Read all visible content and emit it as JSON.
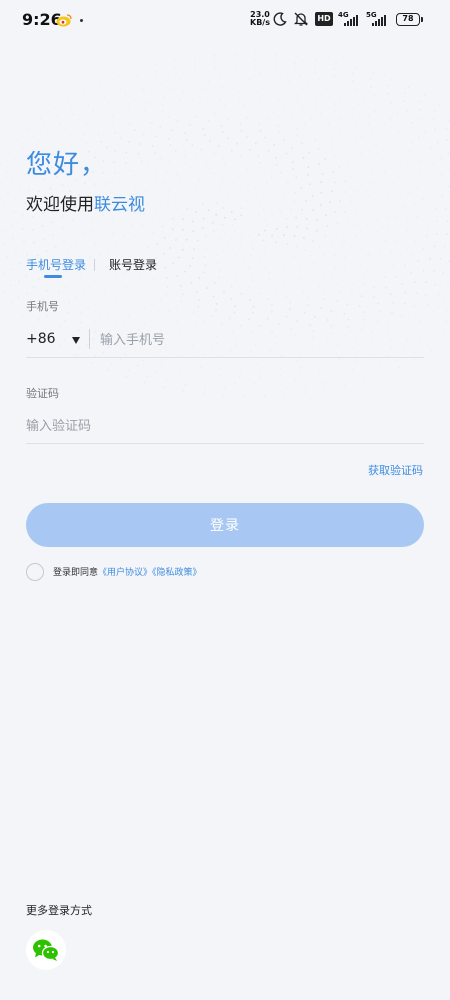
{
  "status_bar": {
    "time": "9:26",
    "net_speed_value": "23.0",
    "net_speed_unit": "KB/s",
    "hd_label": "HD",
    "network_1": "4G",
    "network_2": "5G",
    "battery": "78"
  },
  "header": {
    "greeting": "您好，",
    "welcome_prefix": "欢迎使用",
    "app_name": "联云视"
  },
  "tabs": {
    "phone_login": "手机号登录",
    "account_login": "账号登录"
  },
  "form": {
    "phone_label": "手机号",
    "country_code": "+86",
    "phone_placeholder": "输入手机号",
    "code_label": "验证码",
    "code_placeholder": "输入验证码",
    "get_code": "获取验证码",
    "login_button": "登录"
  },
  "agreement": {
    "prefix": "登录即同意",
    "user_agreement": "《用户协议》",
    "privacy_policy": "《隐私政策》"
  },
  "more_login": {
    "label": "更多登录方式",
    "wechat_icon": "wechat-icon"
  },
  "colors": {
    "accent": "#3d8be0",
    "button_disabled": "#a8c8f3",
    "background": "#f3f5f9",
    "wechat": "#2dc100"
  }
}
